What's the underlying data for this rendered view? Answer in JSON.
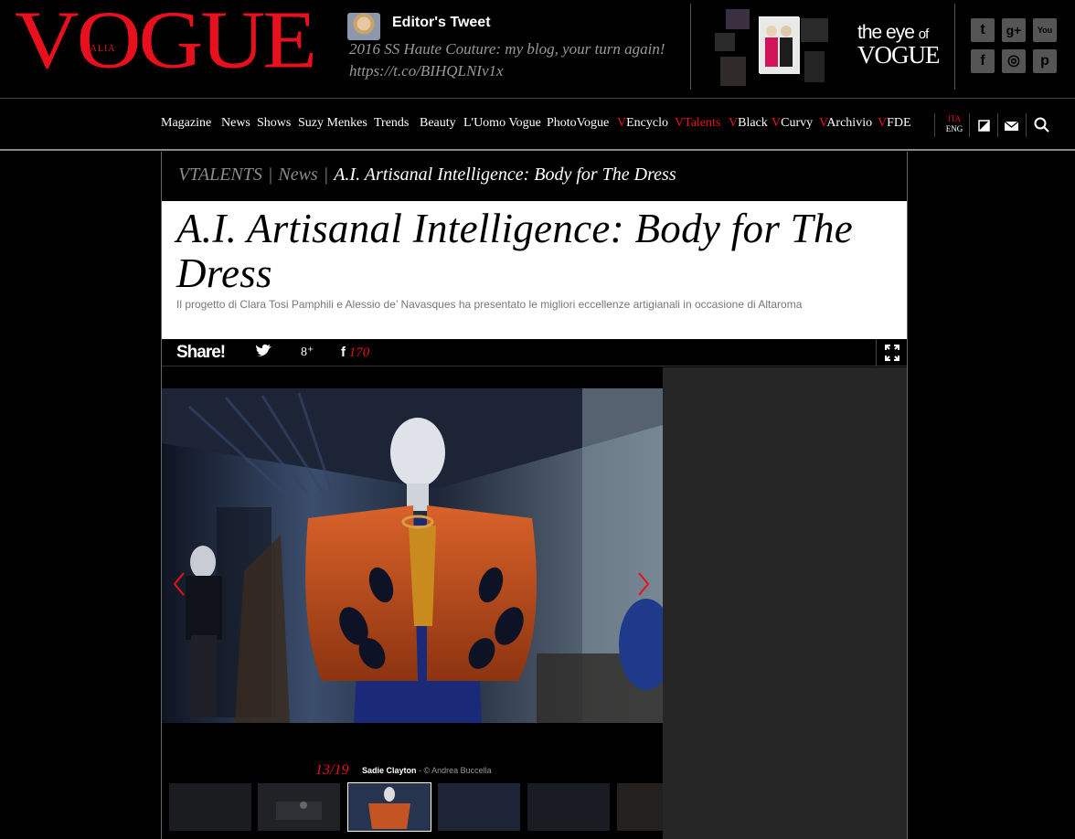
{
  "header": {
    "logo": "VOGUE",
    "logo_sub": "ITALIA",
    "tweet": {
      "title": "Editor's Tweet",
      "text": "2016 SS Haute Couture: my blog, your turn again!",
      "link": "https://t.co/BIHQLNIv1x"
    },
    "eye": {
      "line1": "the eye",
      "line1_small": "of",
      "line2": "VOGUE"
    },
    "social": [
      {
        "icon": "twitter-icon",
        "glyph": "t"
      },
      {
        "icon": "googleplus-icon",
        "glyph": "g+"
      },
      {
        "icon": "youtube-icon",
        "glyph": "You"
      },
      {
        "icon": "facebook-icon",
        "glyph": "f"
      },
      {
        "icon": "instagram-icon",
        "glyph": "◎"
      },
      {
        "icon": "pinterest-icon",
        "glyph": "p"
      }
    ]
  },
  "nav": {
    "items": [
      {
        "prefix": "",
        "label": "Magazine"
      },
      {
        "prefix": "",
        "label": "News"
      },
      {
        "prefix": "",
        "label": "Shows"
      },
      {
        "prefix": "",
        "label": "Suzy Menkes"
      },
      {
        "prefix": "",
        "label": "Trends"
      },
      {
        "prefix": "",
        "label": "Beauty"
      },
      {
        "prefix": "",
        "label": "L'Uomo Vogue"
      },
      {
        "prefix": "",
        "label": "PhotoVogue"
      },
      {
        "prefix": "V",
        "label": "Encyclo"
      },
      {
        "prefix": "V",
        "label": "Talents"
      },
      {
        "prefix": "V",
        "label": "Black"
      },
      {
        "prefix": "V",
        "label": "Curvy"
      },
      {
        "prefix": "V",
        "label": "Archivio"
      },
      {
        "prefix": "V",
        "label": "FDE"
      }
    ],
    "lang_active": "ITA",
    "lang_other": "ENG"
  },
  "article": {
    "breadcrumb": {
      "section": "VTALENTS",
      "category": "News",
      "current": "A.I. Artisanal Intelligence: Body for The Dress",
      "sep": "|"
    },
    "title": "A.I. Artisanal Intelligence: Body for The Dress",
    "subtitle": "Il progetto di Clara Tosi Pamphili e Alessio de’ Navasques ha presentato le migliori eccellenze artigianali in occasione di Altaroma",
    "share": {
      "label": "Share!",
      "facebook_glyph": "f",
      "facebook_count": "170",
      "gplus_glyph": "8⁺"
    },
    "gallery": {
      "counter": "13/19",
      "caption_name": "Sadie Clayton",
      "caption_credit": " - © Andrea Buccella",
      "active_thumb": 2
    }
  },
  "colors": {
    "accent": "#e8101c",
    "panel": "#262626",
    "muted": "#8a8a8a"
  }
}
